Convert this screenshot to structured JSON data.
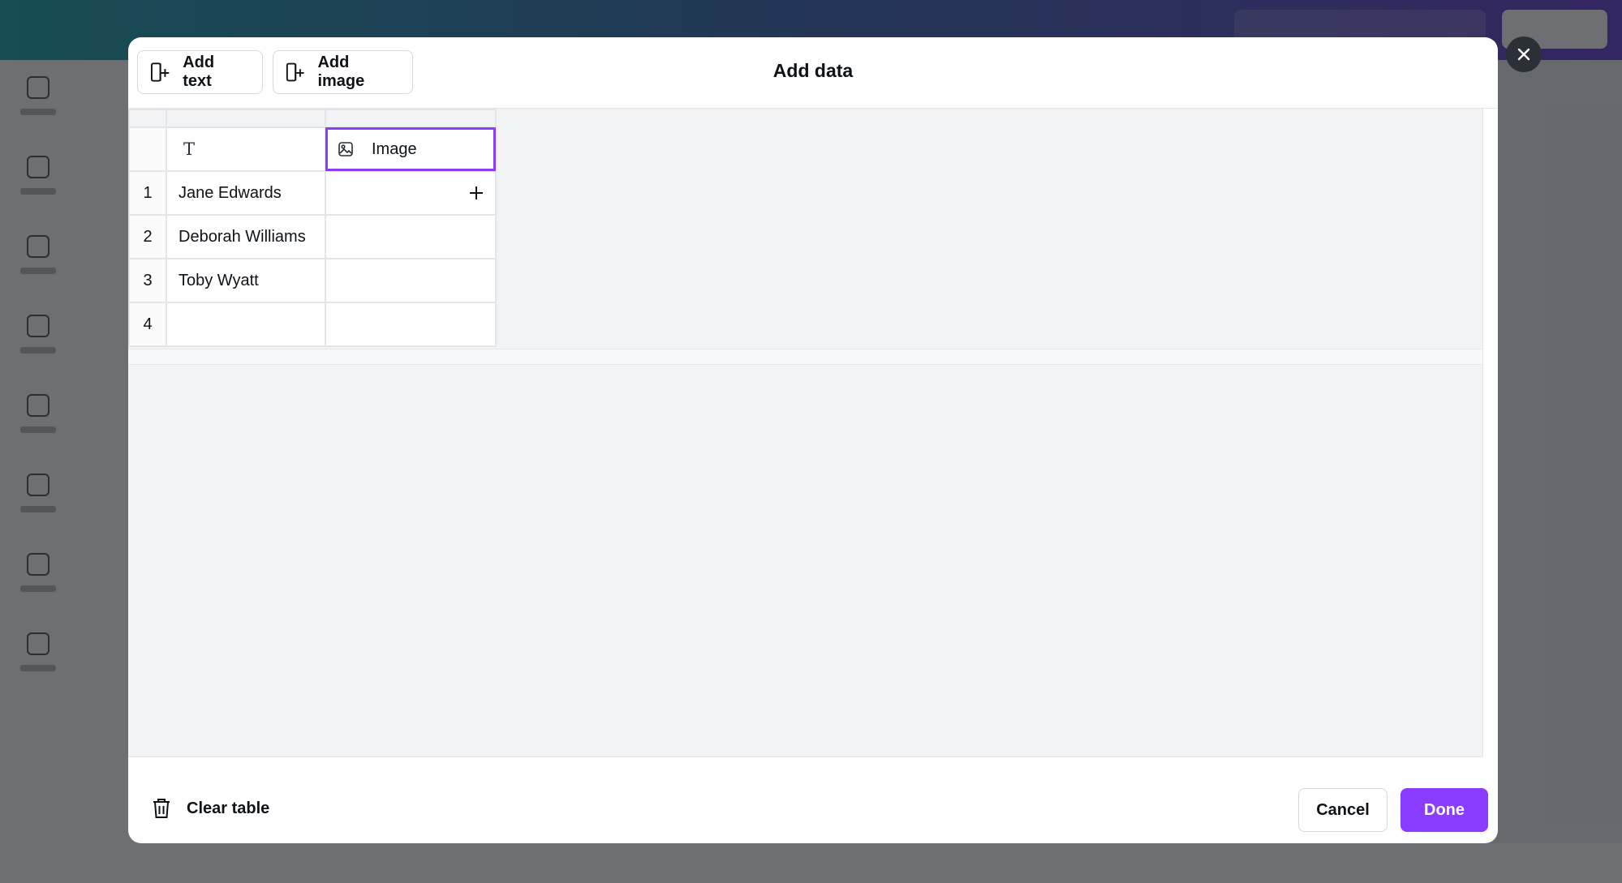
{
  "modal": {
    "title": "Add data",
    "add_text_label": "Add text",
    "add_image_label": "Add image",
    "clear_table_label": "Clear table",
    "cancel_label": "Cancel",
    "done_label": "Done"
  },
  "table": {
    "columns": [
      {
        "type": "text",
        "icon": "text-type-icon",
        "label": ""
      },
      {
        "type": "image",
        "icon": "image-type-icon",
        "label": "Image"
      }
    ],
    "rows": [
      {
        "num": "1",
        "text": "Jane Edwards",
        "image": ""
      },
      {
        "num": "2",
        "text": "Deborah Williams",
        "image": ""
      },
      {
        "num": "3",
        "text": "Toby Wyatt",
        "image": ""
      },
      {
        "num": "4",
        "text": "",
        "image": ""
      }
    ]
  },
  "colors": {
    "accent": "#8b3dff",
    "overlay": "#14161c",
    "close_button": "#2b2f36"
  }
}
